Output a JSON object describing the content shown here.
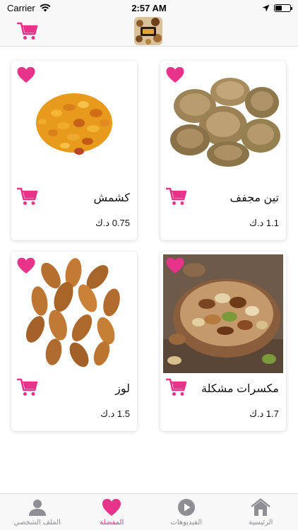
{
  "status_bar": {
    "carrier": "Carrier",
    "time": "2:57 AM"
  },
  "colors": {
    "accent": "#e8338a",
    "tab_inactive": "#8e8e93"
  },
  "products": [
    {
      "name": "تين مجفف",
      "price": "1.1 د.ك",
      "image": "dried-figs",
      "favorite": true
    },
    {
      "name": "كشمش",
      "price": "0.75 د.ك",
      "image": "raisins",
      "favorite": true
    },
    {
      "name": "مكسرات مشكلة",
      "price": "1.7 د.ك",
      "image": "mixed-nuts",
      "favorite": true
    },
    {
      "name": "لوز",
      "price": "1.5 د.ك",
      "image": "almonds",
      "favorite": true
    }
  ],
  "tabs": [
    {
      "label": "الرئيسية",
      "icon": "home-icon",
      "active": false
    },
    {
      "label": "الفيديوهات",
      "icon": "play-icon",
      "active": false
    },
    {
      "label": "المفضلة",
      "icon": "heart-icon",
      "active": true
    },
    {
      "label": "الملف الشخصي",
      "icon": "person-icon",
      "active": false
    }
  ]
}
